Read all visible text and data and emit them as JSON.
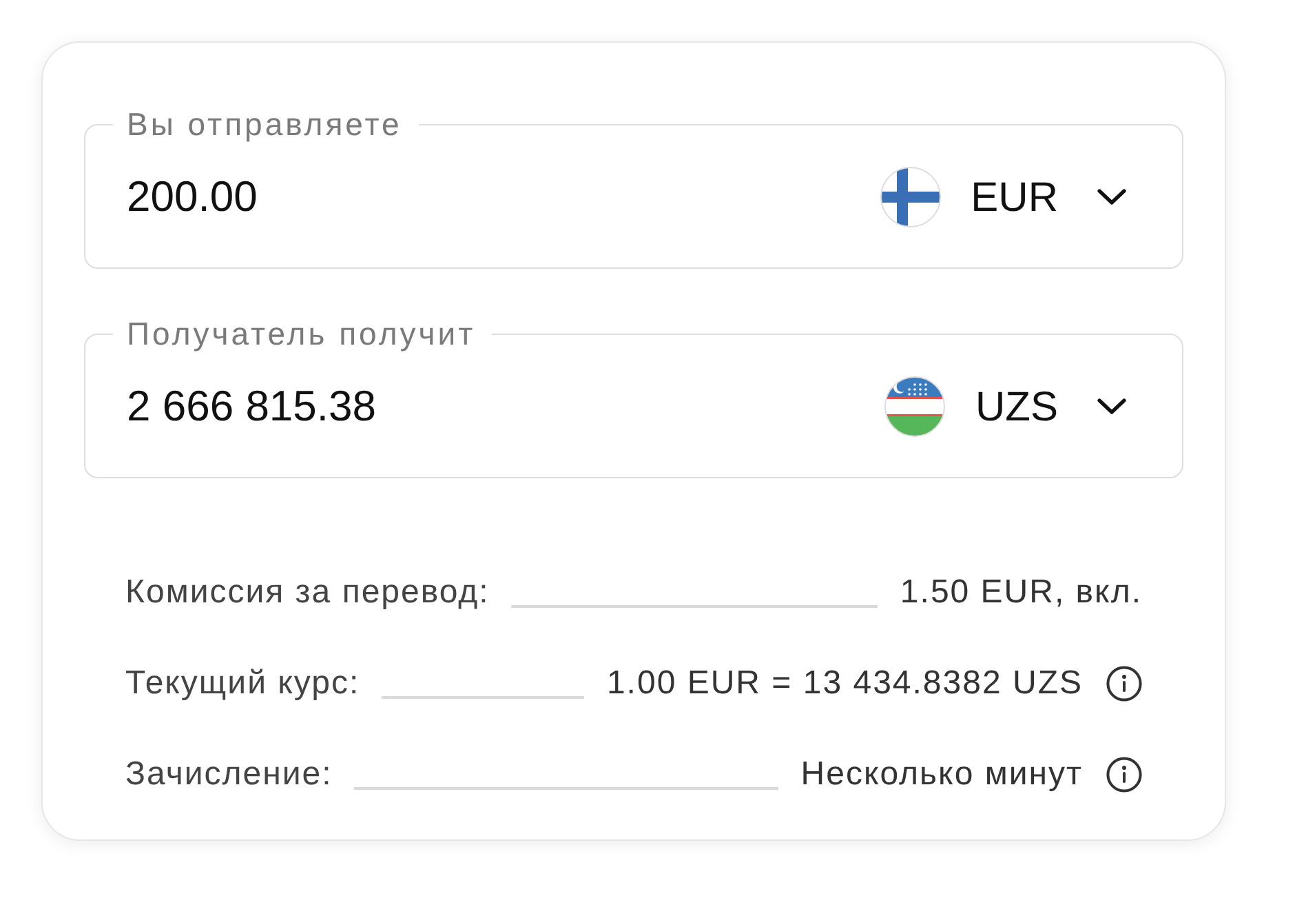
{
  "transfer": {
    "fields": [
      {
        "label": "Вы отправляете",
        "value": "200.00",
        "currency": "EUR"
      },
      {
        "label": "Получатель получит",
        "value": "2 666 815.38",
        "currency": "UZS"
      }
    ],
    "details": [
      {
        "label": "Комиссия за перевод:",
        "value": "1.50 EUR, вкл.",
        "info": false
      },
      {
        "label": "Текущий курс:",
        "value": "1.00 EUR = 13 434.8382 UZS",
        "info": true
      },
      {
        "label": "Зачисление:",
        "value": "Несколько минут",
        "info": true
      }
    ]
  }
}
